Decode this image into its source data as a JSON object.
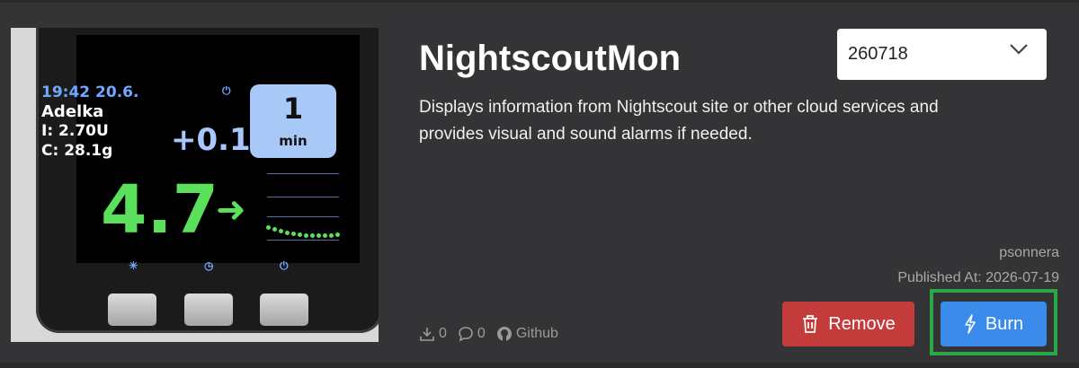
{
  "app": {
    "title": "NightscoutMon",
    "description": "Displays information from Nightscout site or other cloud services and provides visual and sound alarms if needed.",
    "version_selected": "260718",
    "author": "psonnera",
    "published": "Published At: 2026-07-19"
  },
  "stats": {
    "downloads": "0",
    "comments": "0",
    "github_label": "Github"
  },
  "actions": {
    "remove_label": "Remove",
    "burn_label": "Burn"
  },
  "device_screen": {
    "time": "19:42  20.6.",
    "name": "Adelka",
    "insulin": "I: 2.70U",
    "carbs": "C: 28.1g",
    "delta": "+0.1",
    "minutes": "1",
    "minutes_unit": "min",
    "glucose": "4.7"
  },
  "colors": {
    "remove": "#c33b3b",
    "burn": "#3b8beb",
    "highlight": "#2aa845"
  }
}
